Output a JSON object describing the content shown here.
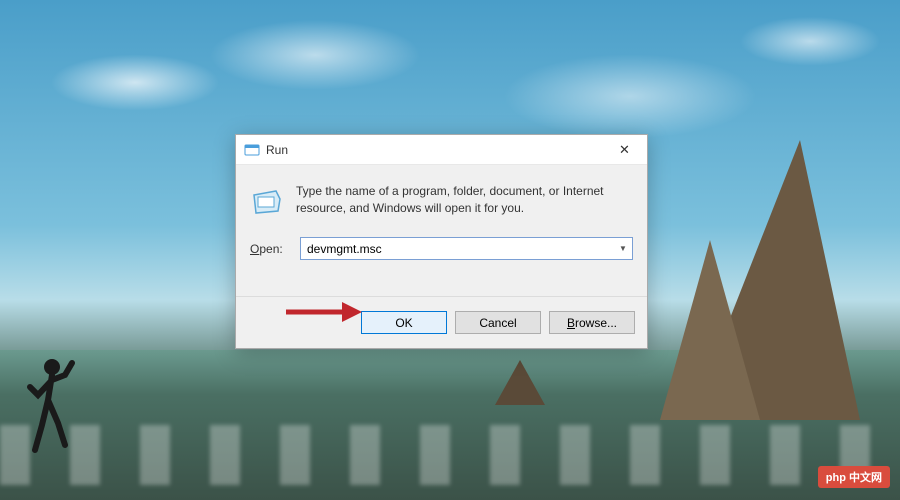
{
  "dialog": {
    "title": "Run",
    "description": "Type the name of a program, folder, document, or Internet resource, and Windows will open it for you.",
    "open_label_underlined": "O",
    "open_label_rest": "pen:",
    "input_value": "devmgmt.msc",
    "buttons": {
      "ok": "OK",
      "cancel": "Cancel",
      "browse_underlined": "B",
      "browse_rest": "rowse..."
    },
    "close_glyph": "✕"
  },
  "watermark": "php 中文网",
  "colors": {
    "accent": "#0078d7",
    "arrow": "#c1272d"
  }
}
